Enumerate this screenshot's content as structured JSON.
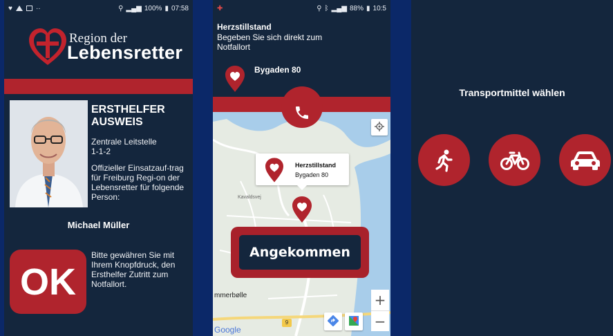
{
  "screen1": {
    "status": {
      "battery": "100%",
      "time": "07:58"
    },
    "brand": {
      "line1": "Region der",
      "line2": "Lebensretter"
    },
    "card": {
      "heading": "ERSTHELFER AUSWEIS",
      "dispatch": "Zentrale Leitstelle",
      "number": "1-1-2",
      "mission": "Offizieller Einsatzauf-trag für Freiburg Regi-on der Lebensretter für folgende Person:",
      "name": "Michael Müller"
    },
    "ok_label": "OK",
    "ok_text": "Bitte gewähren Sie mit Ihrem Knopfdruck, den Ersthelfer Zutritt zum Notfallort."
  },
  "screen2": {
    "status": {
      "battery": "88%",
      "time": "10:5"
    },
    "alert_title": "Herzstillstand",
    "alert_text": "Begeben Sie sich direkt zum Notfallort",
    "address": "Bygaden 80",
    "popup": {
      "title": "Herzstillstand",
      "address": "Bygaden 80"
    },
    "arrived_label": "Angekommen",
    "map_labels": {
      "town": "mmerbølle",
      "google": "Google",
      "route": "9",
      "kav": "Kavaldsvej"
    },
    "zoom_in": "+",
    "zoom_out": "−"
  },
  "screen3": {
    "title": "Transportmittel wählen",
    "options": [
      "walk-icon",
      "bicycle-icon",
      "car-icon"
    ]
  },
  "colors": {
    "primary_red": "#b0242d",
    "panel_navy": "#14263d",
    "background_blue": "#0b2868"
  }
}
